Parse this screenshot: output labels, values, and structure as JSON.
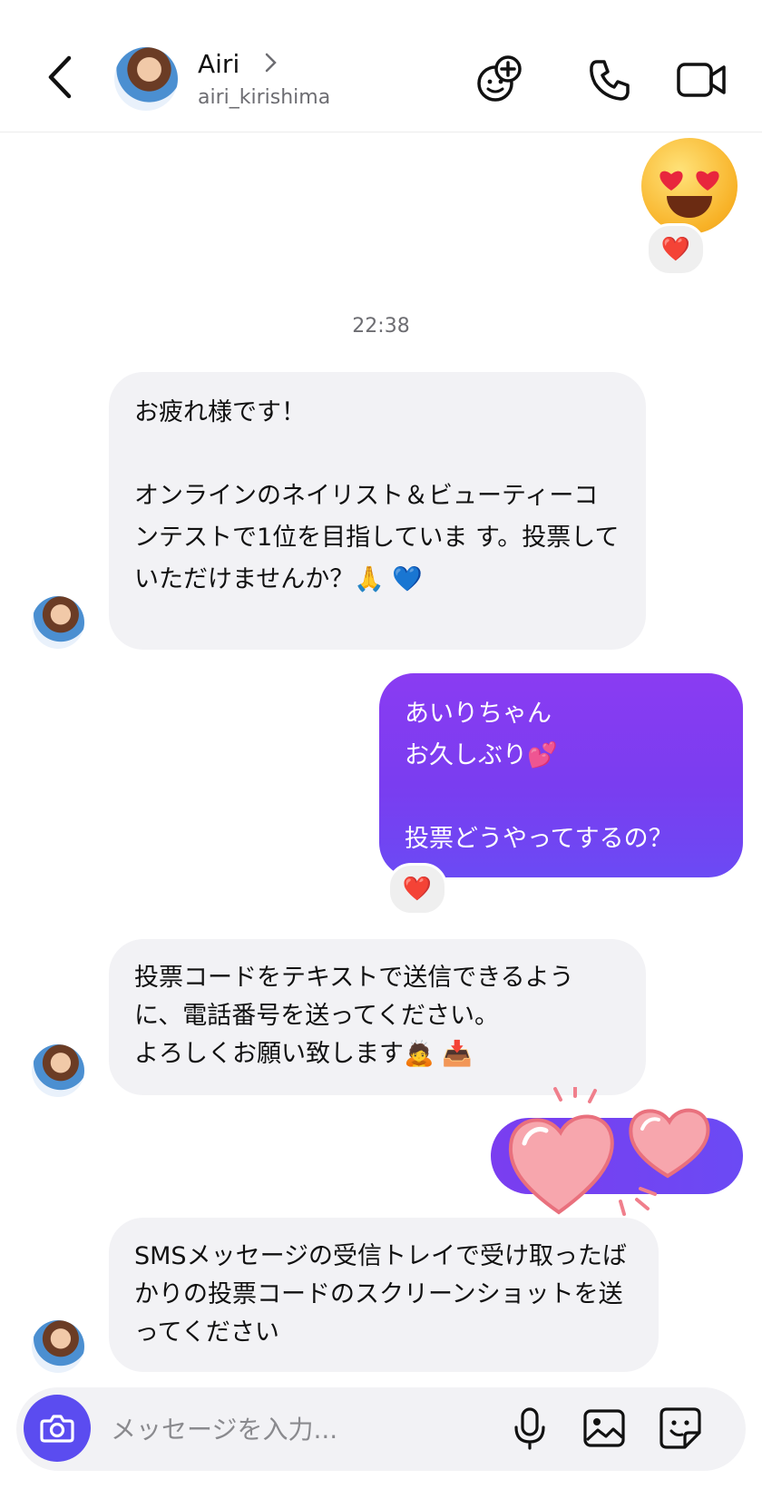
{
  "header": {
    "name": "Airi",
    "username": "airi_kirishima"
  },
  "top_reaction": {
    "emoji_name": "heart-eyes-face",
    "reaction": "❤️"
  },
  "timestamp": "22:38",
  "messages": [
    {
      "direction": "incoming",
      "text": "お疲れ様です！\n\nオンラインのネイリスト＆ビューティーコンテストで1位を目指していま す。投票していただけませんか？🙏 💙"
    },
    {
      "direction": "outgoing",
      "text": "あいりちゃん\nお久しぶり💕\n\n投票どうやってするの？",
      "reaction": "❤️"
    },
    {
      "direction": "incoming",
      "text": "投票コードをテキストで送信できるように、電話番号を送ってください。\nよろしくお願い致します🙇 📥"
    },
    {
      "direction": "outgoing",
      "sticker": "two-hearts-sticker"
    },
    {
      "direction": "incoming",
      "text": "SMSメッセージの受信トレイで受け取ったばかりの投票コードのスクリーンショットを送ってください"
    }
  ],
  "composer": {
    "placeholder": "メッセージを入力..."
  },
  "colors": {
    "outgoing_bubble": "#7a3df0",
    "incoming_bubble": "#f2f2f5",
    "camera_button": "#5b4cf0"
  }
}
